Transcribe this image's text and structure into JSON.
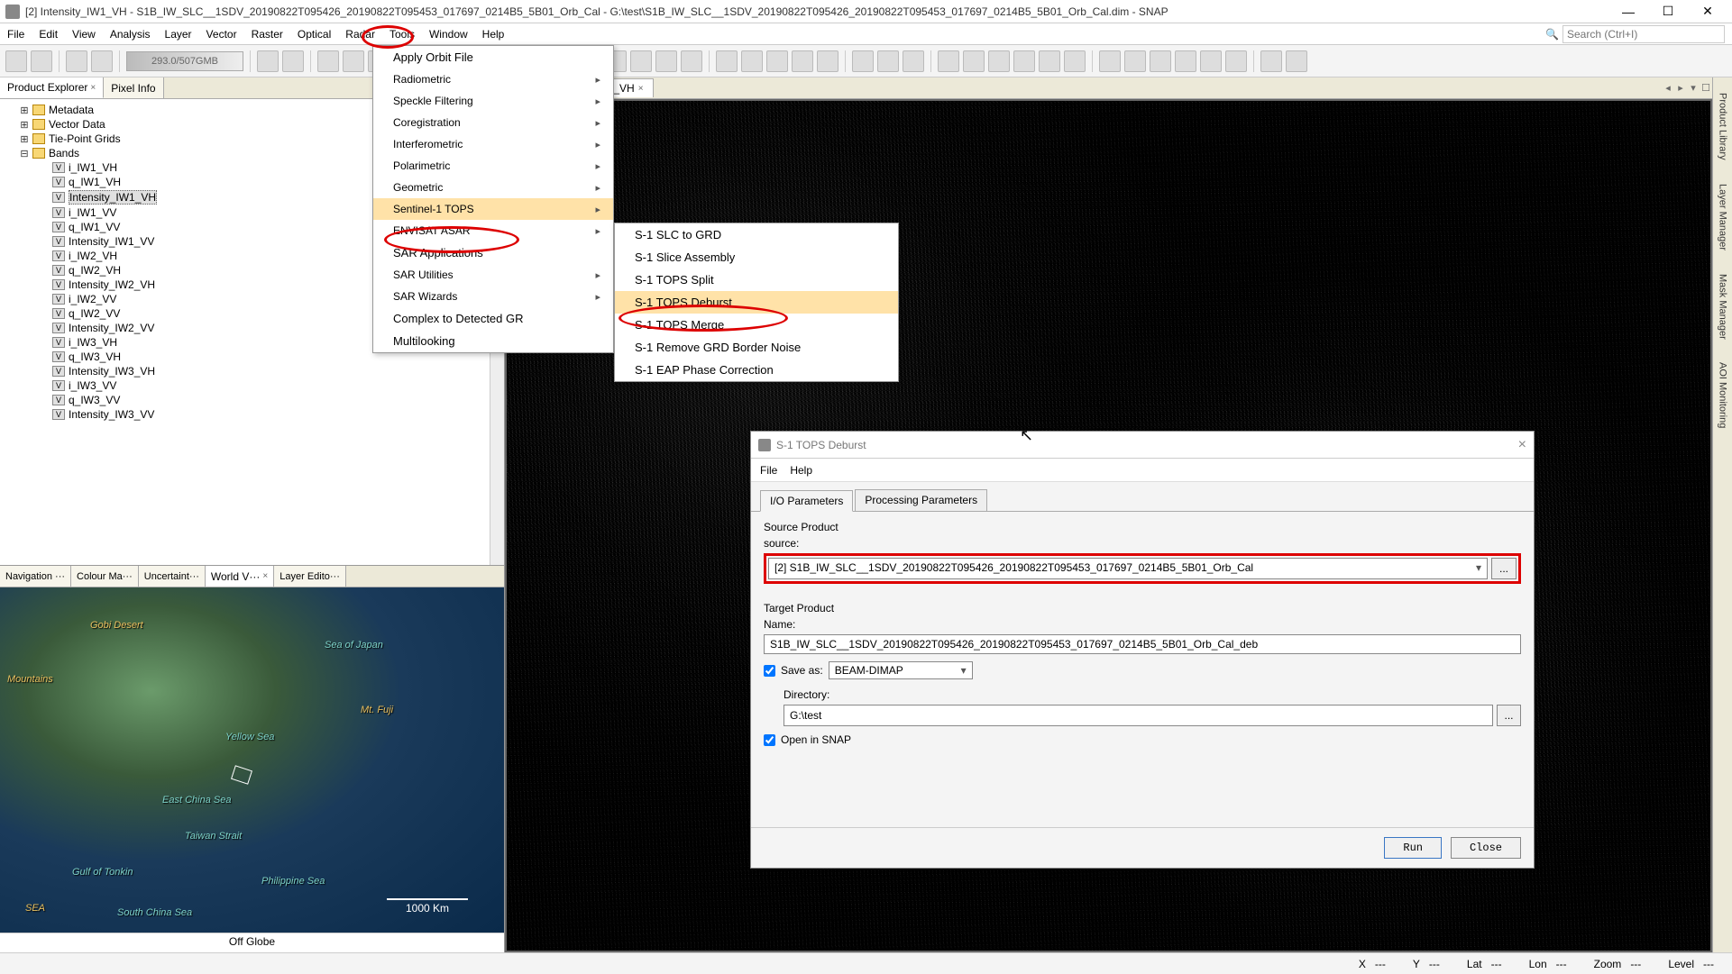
{
  "title": "[2] Intensity_IW1_VH - S1B_IW_SLC__1SDV_20190822T095426_20190822T095453_017697_0214B5_5B01_Orb_Cal - G:\\test\\S1B_IW_SLC__1SDV_20190822T095426_20190822T095453_017697_0214B5_5B01_Orb_Cal.dim - SNAP",
  "menu": {
    "file": "File",
    "edit": "Edit",
    "view": "View",
    "analysis": "Analysis",
    "layer": "Layer",
    "vector": "Vector",
    "raster": "Raster",
    "optical": "Optical",
    "radar": "Radar",
    "tools": "Tools",
    "window": "Window",
    "help": "Help"
  },
  "search_placeholder": "Search (Ctrl+I)",
  "toolbar_slider": "293.0/507GMB",
  "left_tabs": {
    "explorer": "Product Explorer",
    "pixel": "Pixel Info"
  },
  "tree": {
    "metadata": "Metadata",
    "vector": "Vector Data",
    "tiepoint": "Tie-Point Grids",
    "bands": "Bands",
    "items": [
      "i_IW1_VH",
      "q_IW1_VH",
      "Intensity_IW1_VH",
      "i_IW1_VV",
      "q_IW1_VV",
      "Intensity_IW1_VV",
      "i_IW2_VH",
      "q_IW2_VH",
      "Intensity_IW2_VH",
      "i_IW2_VV",
      "q_IW2_VV",
      "Intensity_IW2_VV",
      "i_IW3_VH",
      "q_IW3_VH",
      "Intensity_IW3_VH",
      "i_IW3_VV",
      "q_IW3_VV",
      "Intensity_IW3_VV"
    ]
  },
  "bl_tabs": {
    "nav": "Navigation ···",
    "colour": "Colour Ma···",
    "uncert": "Uncertaint···",
    "world": "World V···",
    "layer": "Layer Edito···"
  },
  "map": {
    "gobi": "Gobi Desert",
    "mountains": "Mountains",
    "sea_japan": "Sea of Japan",
    "fuji": "Mt. Fuji",
    "yellow": "Yellow Sea",
    "east_china": "East China Sea",
    "taiwan": "Taiwan Strait",
    "tonkin": "Gulf of Tonkin",
    "phil": "Philippine Sea",
    "sea": "SEA",
    "south_china": "South China Sea",
    "scale": "1000 Km",
    "off_globe": "Off Globe"
  },
  "center_tab": "[2] Intensity_IW1_VH",
  "radar_menu": {
    "apply_orbit": "Apply Orbit File",
    "radiometric": "Radiometric",
    "speckle": "Speckle Filtering",
    "coreg": "Coregistration",
    "interf": "Interferometric",
    "polar": "Polarimetric",
    "geom": "Geometric",
    "sentinel": "Sentinel-1 TOPS",
    "envisat": "ENVISAT ASAR",
    "sar_app": "SAR Applications",
    "sar_util": "SAR Utilities",
    "sar_wiz": "SAR Wizards",
    "complex": "Complex to Detected GR",
    "multi": "Multilooking"
  },
  "sentinel_menu": {
    "slc_grd": "S-1 SLC to GRD",
    "slice": "S-1 Slice Assembly",
    "split": "S-1 TOPS Split",
    "deburst": "S-1 TOPS Deburst",
    "merge": "S-1 TOPS Merge",
    "border": "S-1 Remove GRD Border Noise",
    "eap": "S-1 EAP Phase Correction"
  },
  "dialog": {
    "title": "S-1 TOPS Deburst",
    "file": "File",
    "help": "Help",
    "tab_io": "I/O Parameters",
    "tab_proc": "Processing Parameters",
    "source_product": "Source Product",
    "source": "source:",
    "source_value": "[2] S1B_IW_SLC__1SDV_20190822T095426_20190822T095453_017697_0214B5_5B01_Orb_Cal",
    "target_product": "Target Product",
    "name": "Name:",
    "name_value": "S1B_IW_SLC__1SDV_20190822T095426_20190822T095453_017697_0214B5_5B01_Orb_Cal_deb",
    "save_as": "Save as:",
    "format": "BEAM-DIMAP",
    "directory": "Directory:",
    "dir_value": "G:\\test",
    "open_in_snap": "Open in SNAP",
    "run": "Run",
    "close": "Close"
  },
  "right_tabs": {
    "prod": "Product Library",
    "layer": "Layer Manager",
    "mask": "Mask Manager",
    "aoi": "AOI Monitoring"
  },
  "status": {
    "x": "X",
    "y": "Y",
    "lat": "Lat",
    "lon": "Lon",
    "zoom": "Zoom",
    "level": "Level",
    "dash": "---"
  }
}
